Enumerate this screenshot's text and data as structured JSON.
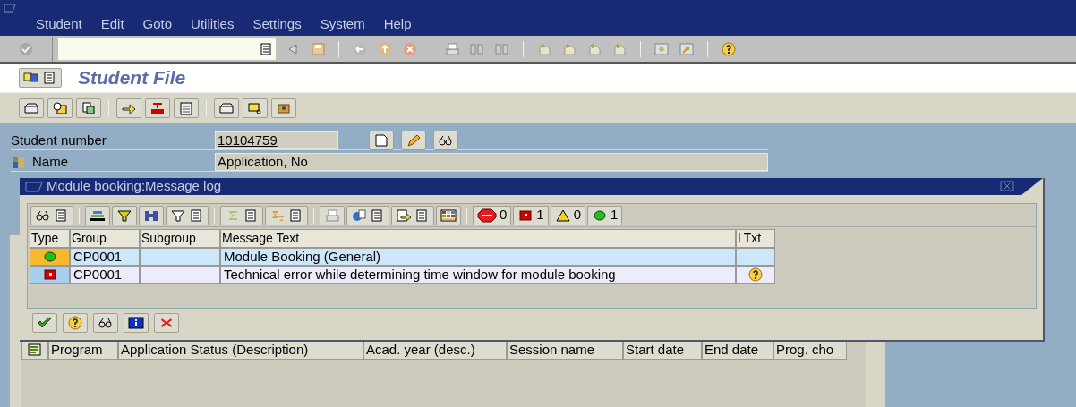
{
  "menu": [
    "Student",
    "Edit",
    "Goto",
    "Utilities",
    "Settings",
    "System",
    "Help"
  ],
  "screen_title": "Student File",
  "fields": [
    {
      "label": "Student number",
      "value": "10104759",
      "kind": "key"
    },
    {
      "label": "Name",
      "value": "Application, No",
      "kind": "person"
    }
  ],
  "dialog": {
    "title": "Module booking:Message log",
    "status_counts": [
      {
        "kind": "stop",
        "count": "0"
      },
      {
        "kind": "error",
        "count": "1"
      },
      {
        "kind": "warning",
        "count": "0"
      },
      {
        "kind": "success",
        "count": "1"
      }
    ],
    "columns": [
      "Type",
      "Group",
      "Subgroup",
      "Message Text",
      "LTxt"
    ],
    "rows": [
      {
        "kind": "success",
        "group": "CP0001",
        "text": "Module Booking (General)",
        "long_text": false,
        "selected": true
      },
      {
        "kind": "error",
        "group": "CP0001",
        "text": "Technical error while determining time window for module booking",
        "long_text": true,
        "selected": false
      }
    ]
  },
  "grid": {
    "columns": [
      "Program",
      "Application Status (Description)",
      "Acad. year (desc.)",
      "Session name",
      "Start date",
      "End date",
      "Prog. cho"
    ]
  }
}
